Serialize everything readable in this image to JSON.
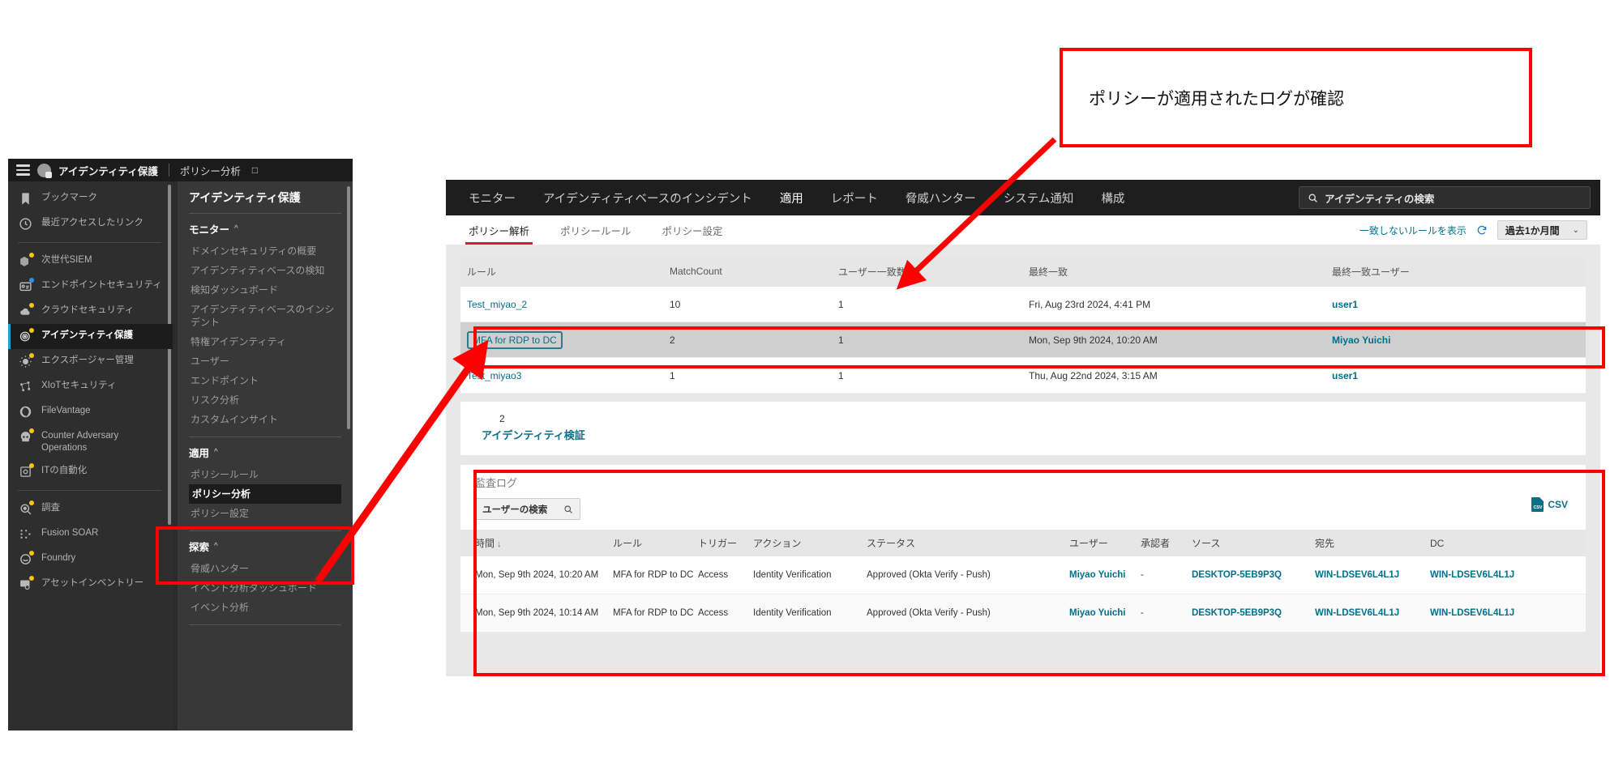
{
  "sidebar_window": {
    "topbar": {
      "menu_icon": "hamburger-icon",
      "brand_icon": "fingerprint-shield-icon",
      "title": "アイデンティティ保護",
      "subtitle": "ポリシー分析",
      "pin_icon": "□"
    },
    "nav_items": [
      {
        "label": "ブックマーク",
        "icon": "bookmark-icon",
        "badge": "none",
        "active": false
      },
      {
        "label": "最近アクセスしたリンク",
        "icon": "clock-icon",
        "badge": "none",
        "active": false
      },
      {
        "separator": true
      },
      {
        "label": "次世代SIEM",
        "icon": "siem-stack-icon",
        "badge": "yellow",
        "active": false
      },
      {
        "label": "エンドポイントセキュリティ",
        "icon": "endpoint-card-icon",
        "badge": "blue",
        "active": false
      },
      {
        "label": "クラウドセキュリティ",
        "icon": "cloud-lock-icon",
        "badge": "yellow",
        "active": false
      },
      {
        "label": "アイデンティティ保護",
        "icon": "fingerprint-shield-icon",
        "badge": "yellow",
        "active": true
      },
      {
        "label": "エクスポージャー管理",
        "icon": "sun-burst-icon",
        "badge": "yellow",
        "active": false
      },
      {
        "label": "XIoTセキュリティ",
        "icon": "network-node-icon",
        "badge": "none",
        "active": false
      },
      {
        "label": "FileVantage",
        "icon": "shutter-icon",
        "badge": "none",
        "active": false
      },
      {
        "label": "Counter Adversary Operations",
        "icon": "skull-icon",
        "badge": "yellow",
        "active": false
      },
      {
        "label": "ITの自動化",
        "icon": "automation-gear-icon",
        "badge": "yellow",
        "active": false
      },
      {
        "separator": true
      },
      {
        "label": "調査",
        "icon": "magnifier-target-icon",
        "badge": "yellow",
        "active": false
      },
      {
        "label": "Fusion SOAR",
        "icon": "workflow-icon",
        "badge": "none",
        "active": false
      },
      {
        "label": "Foundry",
        "icon": "foundry-icon",
        "badge": "yellow",
        "active": false
      },
      {
        "label": "アセットインベントリー",
        "icon": "monitor-search-icon",
        "badge": "yellow",
        "active": false
      }
    ],
    "panel": {
      "heading": "アイデンティティ保護",
      "groups": [
        {
          "title": "モニター",
          "caret": "^",
          "links": [
            {
              "label": "ドメインセキュリティの概要",
              "active": false
            },
            {
              "label": "アイデンティティベースの検知",
              "active": false
            },
            {
              "label": "検知ダッシュボード",
              "active": false
            },
            {
              "label": "アイデンティティベースのインシデント",
              "active": false
            },
            {
              "label": "特権アイデンティティ",
              "active": false
            },
            {
              "label": "ユーザー",
              "active": false
            },
            {
              "label": "エンドポイント",
              "active": false
            },
            {
              "label": "リスク分析",
              "active": false
            },
            {
              "label": "カスタムインサイト",
              "active": false
            }
          ]
        },
        {
          "title": "適用",
          "caret": "^",
          "links": [
            {
              "label": "ポリシールール",
              "active": false
            },
            {
              "label": "ポリシー分析",
              "active": true
            },
            {
              "label": "ポリシー設定",
              "active": false
            }
          ]
        },
        {
          "title": "探索",
          "caret": "^",
          "links": [
            {
              "label": "脅威ハンター",
              "active": false
            },
            {
              "label": "イベント分析ダッシュボード",
              "active": false
            },
            {
              "label": "イベント分析",
              "active": false
            }
          ]
        }
      ]
    }
  },
  "console": {
    "top_nav": {
      "items": [
        {
          "label": "モニター",
          "active": false
        },
        {
          "label": "アイデンティティベースのインシデント",
          "active": false
        },
        {
          "label": "適用",
          "active": true
        },
        {
          "label": "レポート",
          "active": false
        },
        {
          "label": "脅威ハンター",
          "active": false
        },
        {
          "label": "システム通知",
          "active": false
        },
        {
          "label": "構成",
          "active": false
        }
      ],
      "search": {
        "icon": "search-icon",
        "label": "アイデンティティの検索"
      }
    },
    "sub_nav": {
      "tabs": [
        {
          "label": "ポリシー解析",
          "active": true
        },
        {
          "label": "ポリシールール",
          "active": false
        },
        {
          "label": "ポリシー設定",
          "active": false
        }
      ],
      "show_unmatched_link": "一致しないルールを表示",
      "refresh_icon": "refresh-icon",
      "date_range": "過去1か月間",
      "date_chevron": "⌄"
    },
    "rules_table": {
      "columns": [
        "ルール",
        "MatchCount",
        "ユーザー一致数",
        "最終一致",
        "最終一致ユーザー"
      ],
      "rows": [
        {
          "rule": "Test_miyao_2",
          "match_count": "10",
          "user_matches": "1",
          "last_match": "Fri, Aug 23rd 2024, 4:41 PM",
          "last_user": "user1",
          "selected": false,
          "focused": false
        },
        {
          "rule": "MFA for RDP to DC",
          "match_count": "2",
          "user_matches": "1",
          "last_match": "Mon, Sep 9th 2024, 10:20 AM",
          "last_user": "Miyao Yuichi",
          "selected": true,
          "focused": true
        },
        {
          "rule": "Test_miyao3",
          "match_count": "1",
          "user_matches": "1",
          "last_match": "Thu, Aug 22nd 2024, 3:15 AM",
          "last_user": "user1",
          "selected": false,
          "focused": false
        }
      ]
    },
    "identity_verification": {
      "count": "2",
      "label": "アイデンティティ検証"
    },
    "audit_log": {
      "title": "監査ログ",
      "search_placeholder": "ユーザーの検索",
      "search_icon": "search-icon",
      "export_icon": "csv-file-icon",
      "export_label": "CSV",
      "columns": [
        "時間",
        "ルール",
        "トリガー",
        "アクション",
        "ステータス",
        "ユーザー",
        "承認者",
        "ソース",
        "宛先",
        "DC"
      ],
      "sort_column": "時間",
      "sort_direction": "↓",
      "rows": [
        {
          "time": "Mon, Sep 9th 2024, 10:20 AM",
          "rule": "MFA for RDP to DC",
          "trigger": "Access",
          "action": "Identity Verification",
          "status": "Approved (Okta Verify - Push)",
          "user": "Miyao Yuichi",
          "approver": "-",
          "source": "DESKTOP-5EB9P3Q",
          "destination": "WIN-LDSEV6L4L1J",
          "dc": "WIN-LDSEV6L4L1J"
        },
        {
          "time": "Mon, Sep 9th 2024, 10:14 AM",
          "rule": "MFA for RDP to DC",
          "trigger": "Access",
          "action": "Identity Verification",
          "status": "Approved (Okta Verify - Push)",
          "user": "Miyao Yuichi",
          "approver": "-",
          "source": "DESKTOP-5EB9P3Q",
          "destination": "WIN-LDSEV6L4L1J",
          "dc": "WIN-LDSEV6L4L1J"
        }
      ]
    }
  },
  "annotations": {
    "callout_text": "ポリシーが適用されたログが確認",
    "accent_color": "#ff0000",
    "link_color": "#00708a",
    "highlight_color": "#e02020"
  }
}
